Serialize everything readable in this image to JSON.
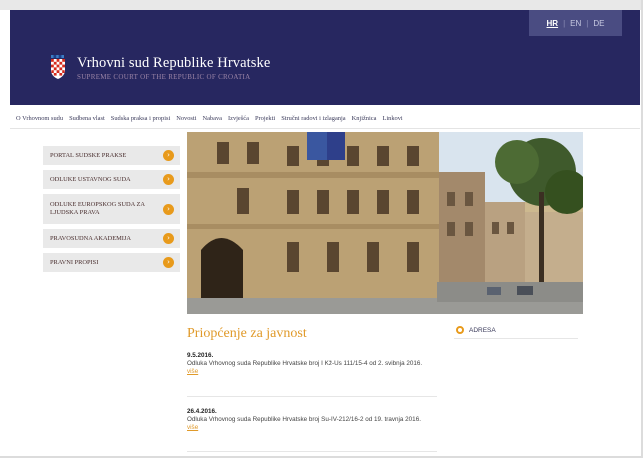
{
  "languages": [
    {
      "label": "HR",
      "active": true
    },
    {
      "label": "EN",
      "active": false
    },
    {
      "label": "DE",
      "active": false
    }
  ],
  "lang_separator": "|",
  "site": {
    "title": "Vrhovni sud Republike Hrvatske",
    "subtitle": "SUPREME COURT OF THE REPUBLIC OF CROATIA"
  },
  "nav": [
    "O Vrhovnom sudu",
    "Sudbena vlast",
    "Sudska praksa i propisi",
    "Novosti",
    "Nabava",
    "Izvješća",
    "Projekti",
    "Stručni radovi i izlaganja",
    "Knjižnica",
    "Linkovi"
  ],
  "sidebar": [
    {
      "label": "PORTAL SUDSKE PRAKSE",
      "name": "sidebar-item-portal-sudske-prakse"
    },
    {
      "label": "ODLUKE USTAVNOG SUDA",
      "name": "sidebar-item-odluke-ustavnog-suda"
    },
    {
      "label": "ODLUKE EUROPSKOG SUDA ZA LJUDSKA PRAVA",
      "name": "sidebar-item-odluke-europskog-suda"
    },
    {
      "label": "PRAVOSUDNA AKADEMIJA",
      "name": "sidebar-item-pravosudna-akademija"
    },
    {
      "label": "PRAVNI PROPISI",
      "name": "sidebar-item-pravni-propisi"
    }
  ],
  "press": {
    "title": "Priopćenje za javnost",
    "items": [
      {
        "date": "9.5.2016.",
        "text": "Odluka Vrhovnog suda Republike Hrvatske broj I Kž-Us 111/15-4 od 2. svibnja 2016.",
        "more": "više"
      },
      {
        "date": "26.4.2016.",
        "text": "Odluka Vrhovnog suda Republike Hrvatske broj Su-IV-212/16-2 od 19. travnja 2016.",
        "more": "više"
      }
    ]
  },
  "address": {
    "label": "ADRESA"
  },
  "colors": {
    "header": "#272760",
    "accent": "#e09a2a",
    "sidebar_bg": "#e9e9e9"
  },
  "icons": {
    "coat": "croatian-coat-of-arms-icon",
    "sidebar_arrow": "chevron-right-icon",
    "address_bullet": "circle-bullet-icon"
  }
}
